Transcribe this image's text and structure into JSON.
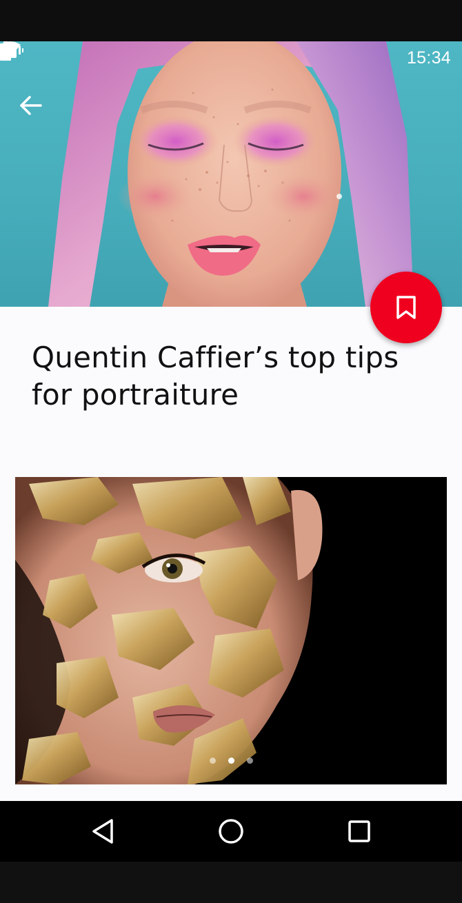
{
  "status_bar": {
    "time": "15:34",
    "icons": [
      "vibrate-icon",
      "wifi-icon",
      "signal-icon",
      "battery-icon"
    ]
  },
  "header": {
    "back_icon": "arrow-left-icon"
  },
  "hero_image": {
    "subject": "portrait-pink-eyeshadow"
  },
  "fab": {
    "icon": "bookmark-icon",
    "color": "#f0001f"
  },
  "article": {
    "title": "Quentin Caffier’s top tips for portraiture"
  },
  "carousel": {
    "page_count": 3,
    "active_index": 1
  },
  "nav_bar": {
    "buttons": [
      "back-triangle-icon",
      "home-circle-icon",
      "recents-square-icon"
    ]
  }
}
